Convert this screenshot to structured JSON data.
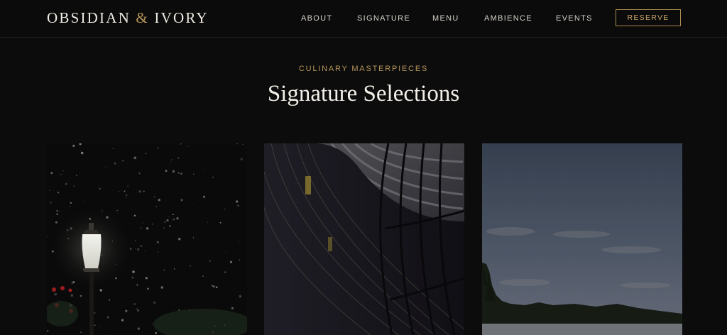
{
  "brand": {
    "name_left": "OBSIDIAN",
    "ampersand": "&",
    "name_right": "IVORY"
  },
  "nav": {
    "items": [
      {
        "label": "ABOUT"
      },
      {
        "label": "SIGNATURE"
      },
      {
        "label": "MENU"
      },
      {
        "label": "AMBIENCE"
      },
      {
        "label": "EVENTS"
      }
    ],
    "reserve_label": "RESERVE"
  },
  "section": {
    "eyebrow": "CULINARY MASTERPIECES",
    "title": "Signature Selections"
  },
  "colors": {
    "background": "#0c0c0c",
    "accent_gold": "#b8975a",
    "text_light": "#f3efe8"
  },
  "cards": [
    {
      "image": "street-lamp-in-snow-photo"
    },
    {
      "image": "curved-library-bookshelves-photo"
    },
    {
      "image": "lakeside-treeline-dusk-photo"
    }
  ]
}
